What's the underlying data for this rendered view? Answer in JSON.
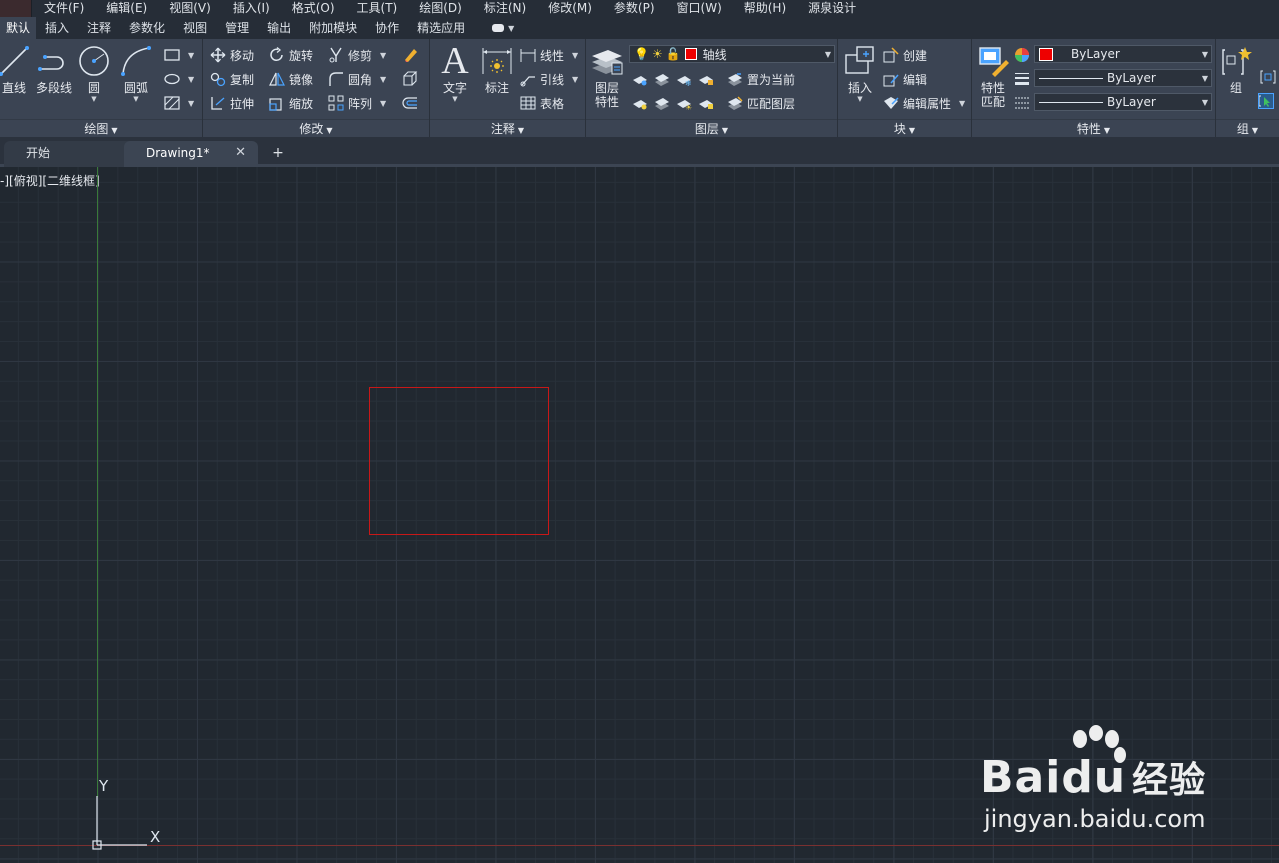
{
  "menubar": {
    "items": [
      "文件(F)",
      "编辑(E)",
      "视图(V)",
      "插入(I)",
      "格式(O)",
      "工具(T)",
      "绘图(D)",
      "标注(N)",
      "修改(M)",
      "参数(P)",
      "窗口(W)",
      "帮助(H)",
      "源泉设计"
    ]
  },
  "ribbon_tabs": [
    "默认",
    "插入",
    "注释",
    "参数化",
    "视图",
    "管理",
    "输出",
    "附加模块",
    "协作",
    "精选应用"
  ],
  "panels": {
    "draw": {
      "title": "绘图",
      "line": "直线",
      "polyline": "多段线",
      "circle": "圆",
      "arc": "圆弧"
    },
    "modify": {
      "title": "修改",
      "move": "移动",
      "rotate": "旋转",
      "trim": "修剪",
      "copy": "复制",
      "mirror": "镜像",
      "fillet": "圆角",
      "stretch": "拉伸",
      "scale": "缩放",
      "array": "阵列"
    },
    "annotation": {
      "title": "注释",
      "text": "文字",
      "dimension": "标注",
      "linear": "线性",
      "leader": "引线",
      "table": "表格"
    },
    "layers": {
      "title": "图层",
      "layer_props_line1": "图层",
      "layer_props_line2": "特性",
      "current_layer": "轴线",
      "layer_color": "#ee0000",
      "make_current": "置为当前",
      "match_layer": "匹配图层"
    },
    "block": {
      "title": "块",
      "insert": "插入",
      "create": "创建",
      "edit": "编辑",
      "edit_attributes": "编辑属性"
    },
    "properties": {
      "title": "特性",
      "match_line1": "特性",
      "match_line2": "匹配",
      "color": "ByLayer",
      "linetype": "ByLayer",
      "lineweight": "ByLayer"
    },
    "groups": {
      "title": "组",
      "group": "组"
    }
  },
  "file_tabs": {
    "start": "开始",
    "drawing": "Drawing1*",
    "close": "✕",
    "new": "+"
  },
  "viewport": {
    "controls": "-][俯视][二维线框]",
    "ucs_y": "Y",
    "ucs_x": "X"
  },
  "watermark": {
    "brand": "Bai",
    "brand_du": "du",
    "brand_cn": "经验",
    "url": "jingyan.baidu.com"
  }
}
